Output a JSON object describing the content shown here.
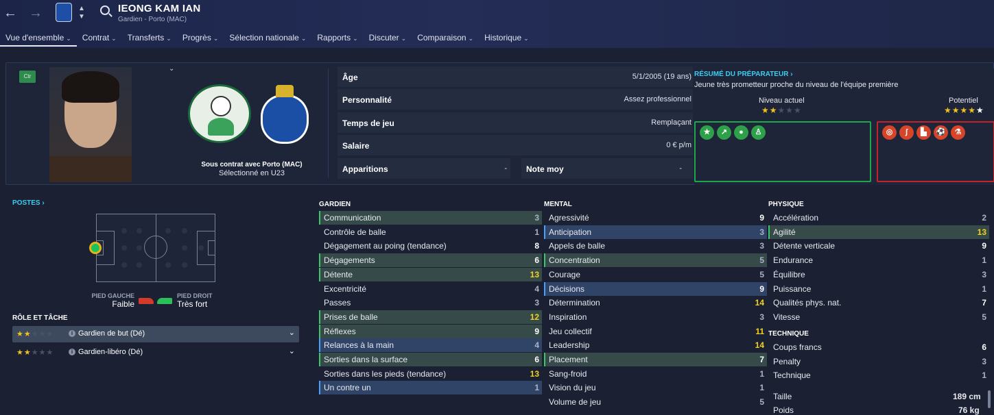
{
  "header": {
    "player_name": "IEONG KAM IAN",
    "player_sub": "Gardien - Porto (MAC)"
  },
  "tabs": [
    {
      "label": "Vue d'ensemble"
    },
    {
      "label": "Contrat"
    },
    {
      "label": "Transferts"
    },
    {
      "label": "Progrès"
    },
    {
      "label": "Sélection nationale"
    },
    {
      "label": "Rapports"
    },
    {
      "label": "Discuter"
    },
    {
      "label": "Comparaison"
    },
    {
      "label": "Historique"
    }
  ],
  "overview": {
    "badge": "Ctr",
    "contract_text": "Sous contrat avec Porto (MAC)",
    "selected_text": "Sélectionné en U23",
    "info": {
      "age_label": "Âge",
      "age_value": "5/1/2005 (19 ans)",
      "personality_label": "Personnalité",
      "personality_value": "Assez professionnel",
      "playtime_label": "Temps de jeu",
      "playtime_value": "Remplaçant",
      "salary_label": "Salaire",
      "salary_value": "0 € p/m",
      "apps_label": "Apparitions",
      "apps_value": "-",
      "rating_label": "Note moy",
      "rating_value": "-"
    },
    "coach": {
      "title": "RÉSUMÉ DU PRÉPARATEUR ›",
      "description": "Jeune très prometteur proche du niveau de l'équipe première",
      "current_label": "Niveau actuel",
      "current_stars": 2,
      "potential_label": "Potentiel",
      "potential_stars": 4.5,
      "strength_icons": [
        "star-icon",
        "trend-up-icon",
        "brain-icon",
        "person-icon"
      ],
      "weakness_icons": [
        "target-icon",
        "foot-icon",
        "boot-icon",
        "ball-icon",
        "flask-icon"
      ]
    }
  },
  "positions": {
    "title": "POSTES ›",
    "left_foot_label": "PIED GAUCHE",
    "left_foot_value": "Faible",
    "right_foot_label": "PIED DROIT",
    "right_foot_value": "Très fort",
    "roles_title": "RÔLE ET TÂCHE",
    "roles": [
      {
        "name": "Gardien de but (Dé)",
        "stars": 2
      },
      {
        "name": "Gardien-libéro (Dé)",
        "stars": 2
      }
    ]
  },
  "attributes": {
    "gardien": {
      "title": "GARDIEN",
      "items": [
        {
          "name": "Communication",
          "value": "3",
          "hl": "green"
        },
        {
          "name": "Contrôle de balle",
          "value": "1",
          "hl": ""
        },
        {
          "name": "Dégagement au poing (tendance)",
          "value": "8",
          "hl": ""
        },
        {
          "name": "Dégagements",
          "value": "6",
          "hl": "green"
        },
        {
          "name": "Détente",
          "value": "13",
          "hl": "green"
        },
        {
          "name": "Excentricité",
          "value": "4",
          "hl": ""
        },
        {
          "name": "Passes",
          "value": "3",
          "hl": ""
        },
        {
          "name": "Prises de balle",
          "value": "12",
          "hl": "green"
        },
        {
          "name": "Réflexes",
          "value": "9",
          "hl": "green"
        },
        {
          "name": "Relances à la main",
          "value": "4",
          "hl": "blue"
        },
        {
          "name": "Sorties dans la surface",
          "value": "6",
          "hl": "green"
        },
        {
          "name": "Sorties dans les pieds (tendance)",
          "value": "13",
          "hl": ""
        },
        {
          "name": "Un contre un",
          "value": "1",
          "hl": "blue"
        }
      ]
    },
    "mental": {
      "title": "MENTAL",
      "items": [
        {
          "name": "Agressivité",
          "value": "9",
          "hl": ""
        },
        {
          "name": "Anticipation",
          "value": "3",
          "hl": "blue"
        },
        {
          "name": "Appels de balle",
          "value": "3",
          "hl": ""
        },
        {
          "name": "Concentration",
          "value": "5",
          "hl": "green"
        },
        {
          "name": "Courage",
          "value": "5",
          "hl": ""
        },
        {
          "name": "Décisions",
          "value": "9",
          "hl": "blue"
        },
        {
          "name": "Détermination",
          "value": "14",
          "hl": ""
        },
        {
          "name": "Inspiration",
          "value": "3",
          "hl": ""
        },
        {
          "name": "Jeu collectif",
          "value": "11",
          "hl": ""
        },
        {
          "name": "Leadership",
          "value": "14",
          "hl": ""
        },
        {
          "name": "Placement",
          "value": "7",
          "hl": "green"
        },
        {
          "name": "Sang-froid",
          "value": "1",
          "hl": ""
        },
        {
          "name": "Vision du jeu",
          "value": "1",
          "hl": ""
        },
        {
          "name": "Volume de jeu",
          "value": "5",
          "hl": ""
        }
      ]
    },
    "physique": {
      "title": "PHYSIQUE",
      "items": [
        {
          "name": "Accélération",
          "value": "2",
          "hl": ""
        },
        {
          "name": "Agilité",
          "value": "13",
          "hl": "green"
        },
        {
          "name": "Détente verticale",
          "value": "9",
          "hl": ""
        },
        {
          "name": "Endurance",
          "value": "1",
          "hl": ""
        },
        {
          "name": "Équilibre",
          "value": "3",
          "hl": ""
        },
        {
          "name": "Puissance",
          "value": "1",
          "hl": ""
        },
        {
          "name": "Qualités phys. nat.",
          "value": "7",
          "hl": ""
        },
        {
          "name": "Vitesse",
          "value": "5",
          "hl": ""
        }
      ]
    },
    "technique": {
      "title": "TECHNIQUE",
      "items": [
        {
          "name": "Coups francs",
          "value": "6",
          "hl": ""
        },
        {
          "name": "Penalty",
          "value": "3",
          "hl": ""
        },
        {
          "name": "Technique",
          "value": "1",
          "hl": ""
        }
      ]
    },
    "height_label": "Taille",
    "height_value": "189 cm",
    "weight_label": "Poids",
    "weight_value": "76 kg"
  }
}
